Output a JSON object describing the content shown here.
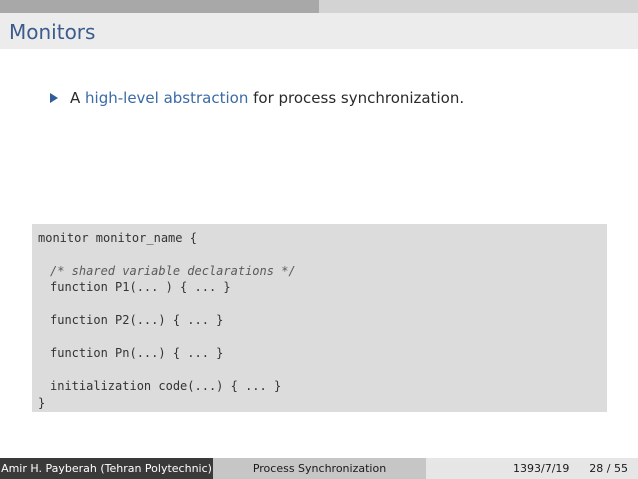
{
  "slide": {
    "title": "Monitors",
    "bullet": {
      "prefix": "A ",
      "highlight": "high-level abstraction",
      "suffix": " for process synchronization."
    },
    "code_lines": [
      "monitor monitor_name {",
      "/* shared variable declarations */",
      "function P1(... ) { ... }",
      "function P2(...) { ... }",
      "function Pn(...) { ... }",
      "initialization code(...) { ... }",
      "}"
    ]
  },
  "footer": {
    "author": "Amir H. Payberah (Tehran Polytechnic)",
    "topic": "Process Synchronization",
    "date": "1393/7/19",
    "page": "28 / 55"
  },
  "colors": {
    "title": "#3b5c8c",
    "highlight": "#3b6aa8",
    "bullet": "#2e5d9a",
    "code_bg": "#dcdcdc",
    "footer_dark": "#3a3a3a",
    "footer_mid": "#c6c6c6",
    "footer_light": "#e6e6e6"
  },
  "icons": {
    "bullet": "triangle-bullet-icon"
  }
}
